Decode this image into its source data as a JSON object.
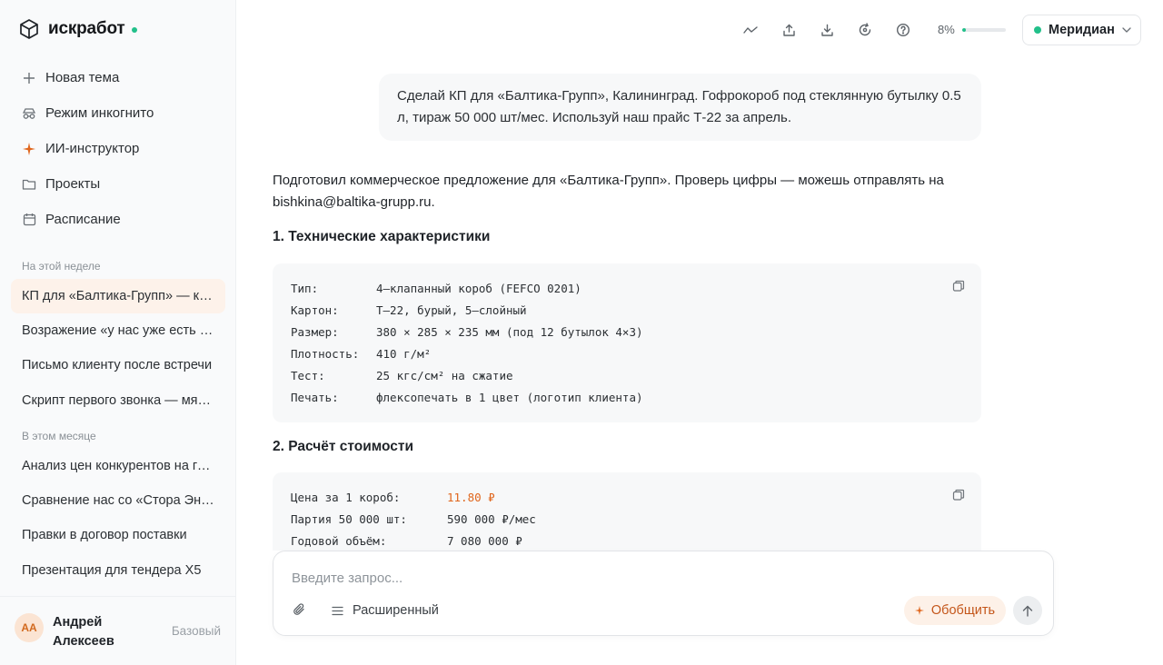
{
  "brand": {
    "name": "искработ"
  },
  "nav": [
    {
      "label": "Новая тема",
      "icon": "plus-icon"
    },
    {
      "label": "Режим инкогнито",
      "icon": "incognito-icon"
    },
    {
      "label": "ИИ-инструктор",
      "icon": "sparkle-icon"
    },
    {
      "label": "Проекты",
      "icon": "folder-icon"
    },
    {
      "label": "Расписание",
      "icon": "calendar-icon"
    }
  ],
  "sections": {
    "week_label": "На этой неделе",
    "month_label": "В этом месяце"
  },
  "history": {
    "week": [
      "КП для «Балтика-Групп» — коммерческое предложение",
      "Возражение «у нас уже есть поставщик»",
      "Письмо клиенту после встречи",
      "Скрипт первого звонка — мясокомбинат"
    ],
    "month": [
      "Анализ цен конкурентов на гофротару",
      "Сравнение нас со «Стора Энсо»",
      "Правки в договор поставки",
      "Презентация для тендера X5"
    ]
  },
  "user": {
    "initials": "АА",
    "name": "Андрей Алексеев",
    "plan": "Базовый"
  },
  "topbar": {
    "progress_label": "8%",
    "progress_value": 0.08,
    "model": "Меридиан"
  },
  "chat": {
    "user_message": "Сделай КП для «Балтика-Групп», Калининград. Гофрокороб под стеклянную бутылку 0.5 л, тираж 50 000 шт/мес. Используй наш прайс Т-22 за апрель.",
    "intro": "Подготовил коммерческое предложение для «Балтика-Групп». Проверь цифры — можешь отправлять на bishkina@baltika-grupp.ru.",
    "section1_title": "1. Технические характеристики",
    "spec_rows": [
      {
        "key": "Тип:",
        "value": "4–клапанный короб (FEFCO 0201)"
      },
      {
        "key": "Картон:",
        "value": "Т–22, бурый, 5–слойный"
      },
      {
        "key": "Размер:",
        "value": "380 × 285 × 235 мм (под 12 бутылок 4×3)"
      },
      {
        "key": "Плотность:",
        "value": "410 г/м²"
      },
      {
        "key": "Тест:",
        "value": "25 кгс/см² на сжатие"
      },
      {
        "key": "Печать:",
        "value": "флексопечать в 1 цвет (логотип клиента)"
      }
    ],
    "section2_title": "2. Расчёт стоимости",
    "price_rows": [
      {
        "key": "Цена за 1 короб:",
        "value": "11.80 ₽"
      },
      {
        "key": "Партия 50 000 шт:",
        "value": "590 000 ₽/мес"
      },
      {
        "key": "Годовой объём:",
        "value": "7 080 000 ₽"
      }
    ]
  },
  "composer": {
    "placeholder": "Введите запрос...",
    "mode_label": "Расширенный",
    "summarize_label": "Обобщить"
  },
  "colors": {
    "accent": "#e0661d",
    "status_green": "#22c08a"
  }
}
